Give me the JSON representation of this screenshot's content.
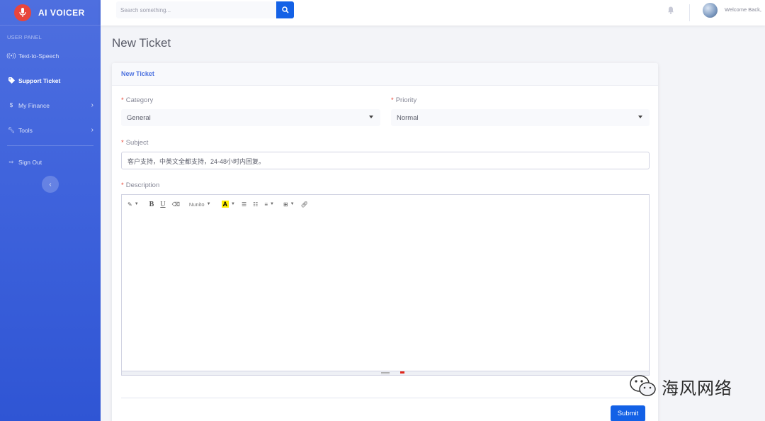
{
  "brand": {
    "name": "AI VOICER"
  },
  "sidebar": {
    "section_heading": "USER PANEL",
    "items": [
      {
        "label": "Text-to-Speech",
        "icon": "broadcast-icon",
        "active": false,
        "has_submenu": false
      },
      {
        "label": "Support Ticket",
        "icon": "tag-icon",
        "active": true,
        "has_submenu": false
      },
      {
        "label": "My Finance",
        "icon": "dollar-icon",
        "active": false,
        "has_submenu": true
      },
      {
        "label": "Tools",
        "icon": "wrench-icon",
        "active": false,
        "has_submenu": true
      }
    ],
    "sign_out": {
      "label": "Sign Out",
      "icon": "sign-out-icon"
    },
    "collapse_icon": "chevron-left-icon"
  },
  "topbar": {
    "search_placeholder": "Search something...",
    "search_icon": "search-icon",
    "bell_icon": "bell-icon",
    "welcome_text": "Welcome Back,"
  },
  "page": {
    "title": "New Ticket"
  },
  "form": {
    "header": "New Ticket",
    "category": {
      "label": "Category",
      "value": "General"
    },
    "priority": {
      "label": "Priority",
      "value": "Normal"
    },
    "subject": {
      "label": "Subject",
      "value": "客户支持，中英文全都支持，24-48小时内回复。"
    },
    "description": {
      "label": "Description",
      "font_name": "Nunito"
    },
    "submit_label": "Submit"
  },
  "colors": {
    "primary": "#1361e6",
    "sidebar_top": "#4e6fdf",
    "sidebar_bottom": "#2f55d4",
    "required": "#e74a3b"
  },
  "watermark": {
    "text": "海风网络"
  }
}
